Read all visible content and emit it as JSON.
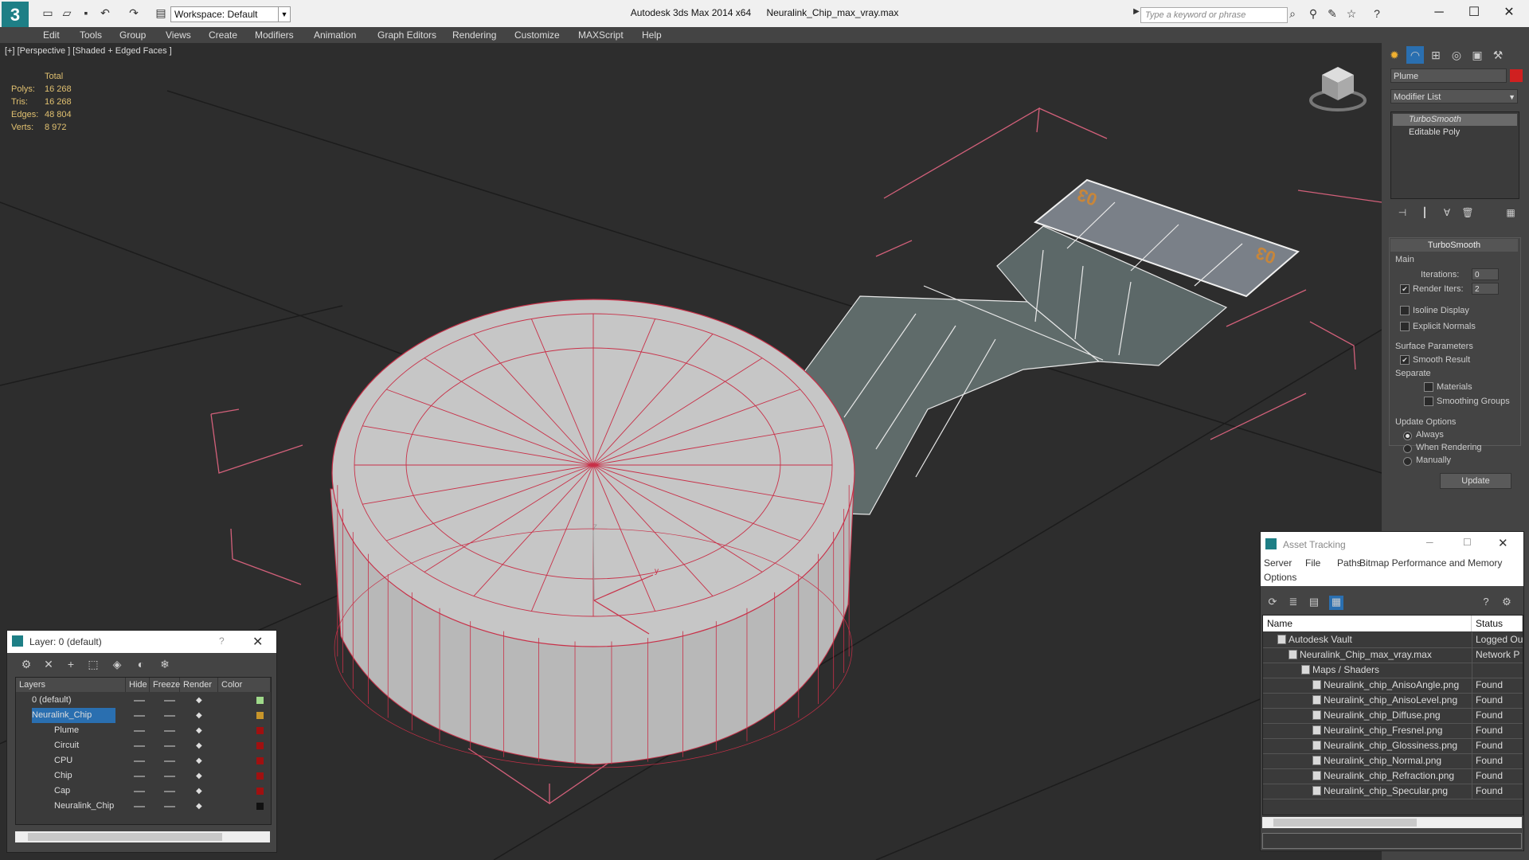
{
  "titlebar": {
    "workspace": "Workspace: Default",
    "app_title": "Autodesk 3ds Max  2014 x64",
    "file_title": "Neuralink_Chip_max_vray.max",
    "search_placeholder": "Type a keyword or phrase"
  },
  "menu": [
    "Edit",
    "Tools",
    "Group",
    "Views",
    "Create",
    "Modifiers",
    "Animation",
    "Graph Editors",
    "Rendering",
    "Customize",
    "MAXScript",
    "Help"
  ],
  "viewport": {
    "label": "[+] [Perspective ] [Shaded + Edged Faces ]",
    "stats": {
      "header": "Total",
      "rows": [
        {
          "label": "Polys:",
          "value": "16 268"
        },
        {
          "label": "Tris:",
          "value": "16 268"
        },
        {
          "label": "Edges:",
          "value": "48 804"
        },
        {
          "label": "Verts:",
          "value": "8 972"
        }
      ]
    },
    "axis_z": "z",
    "axis_y": "y",
    "decal_text": "03",
    "colors": {
      "background": "#2d2d2d",
      "wire": "#c83048",
      "mesh": "#c8c8c8",
      "ribbon": "#5f6b6a",
      "bbox": "#d2607a"
    }
  },
  "command_panel": {
    "object_name": "Plume",
    "object_color": "#d02020",
    "modifier_list": "Modifier List",
    "stack": [
      "TurboSmooth",
      "Editable Poly"
    ],
    "rollout_title": "TurboSmooth",
    "main_label": "Main",
    "iterations_label": "Iterations:",
    "iterations_value": "0",
    "render_iters_label": "Render Iters:",
    "render_iters_value": "2",
    "render_iters_checked": true,
    "isoline_label": "Isoline Display",
    "explicit_normals_label": "Explicit Normals",
    "surface_params_label": "Surface Parameters",
    "smooth_result_label": "Smooth Result",
    "separate_label": "Separate",
    "materials_label": "Materials",
    "smoothing_groups_label": "Smoothing Groups",
    "update_options_label": "Update Options",
    "always_label": "Always",
    "when_rendering_label": "When Rendering",
    "manually_label": "Manually",
    "update_button": "Update"
  },
  "layer_dialog": {
    "title": "Layer: 0 (default)",
    "help": "?",
    "columns": [
      "Layers",
      "Hide",
      "Freeze",
      "Render",
      "Color"
    ],
    "rows": [
      {
        "name": "0 (default)",
        "color": "#9fd98a",
        "selected": false
      },
      {
        "name": "Neuralink_Chip",
        "color": "#c8952a",
        "selected": true
      },
      {
        "name": "Plume",
        "color": "#a01010",
        "selected": false
      },
      {
        "name": "Circuit",
        "color": "#a01010",
        "selected": false
      },
      {
        "name": "CPU",
        "color": "#a01010",
        "selected": false
      },
      {
        "name": "Chip",
        "color": "#a01010",
        "selected": false
      },
      {
        "name": "Cap",
        "color": "#a01010",
        "selected": false
      },
      {
        "name": "Neuralink_Chip",
        "color": "#111111",
        "selected": false
      }
    ]
  },
  "asset_tracking": {
    "title": "Asset Tracking",
    "menu": [
      "Server",
      "File",
      "Paths",
      "Bitmap Performance and Memory",
      "Options"
    ],
    "columns": [
      "Name",
      "Status"
    ],
    "rows": [
      {
        "name": "Autodesk Vault",
        "status": "Logged Ou"
      },
      {
        "name": "Neuralink_Chip_max_vray.max",
        "status": "Network P"
      },
      {
        "name": "Maps / Shaders",
        "status": ""
      },
      {
        "name": "Neuralink_chip_AnisoAngle.png",
        "status": "Found"
      },
      {
        "name": "Neuralink_chip_AnisoLevel.png",
        "status": "Found"
      },
      {
        "name": "Neuralink_chip_Diffuse.png",
        "status": "Found"
      },
      {
        "name": "Neuralink_chip_Fresnel.png",
        "status": "Found"
      },
      {
        "name": "Neuralink_chip_Glossiness.png",
        "status": "Found"
      },
      {
        "name": "Neuralink_chip_Normal.png",
        "status": "Found"
      },
      {
        "name": "Neuralink_chip_Refraction.png",
        "status": "Found"
      },
      {
        "name": "Neuralink_chip_Specular.png",
        "status": "Found"
      }
    ]
  }
}
